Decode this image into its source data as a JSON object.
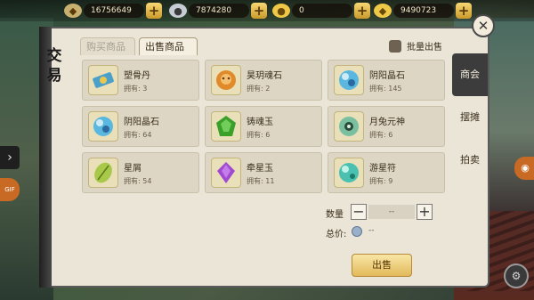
{
  "currencies": [
    {
      "name": "silver-ingot",
      "value": "16756649"
    },
    {
      "name": "silver-coin",
      "value": "7874280"
    },
    {
      "name": "gold-coin",
      "value": "0"
    },
    {
      "name": "gold-ingot",
      "value": "9490723"
    }
  ],
  "panel": {
    "title_line1": "交",
    "title_line2": "易",
    "tabs": [
      "购买商品",
      "出售商品"
    ],
    "active_tab": "出售商品",
    "batch_sell_label": "批量出售",
    "batch_sell_checked": false
  },
  "goods": [
    {
      "name": "塑骨丹",
      "own": "拥有: 3",
      "icon": "scroll-pill-icon",
      "color": "#4aa0c8"
    },
    {
      "name": "昊玥魂石",
      "own": "拥有: 2",
      "icon": "soul-stone-icon",
      "color": "#e08a2a"
    },
    {
      "name": "阴阳晶石",
      "own": "拥有: 145",
      "icon": "crystal-orb-icon",
      "color": "#5ab8e0"
    },
    {
      "name": "阴阳晶石",
      "own": "拥有: 64",
      "icon": "crystal-orb-icon",
      "color": "#5ab8e0"
    },
    {
      "name": "铸魂玉",
      "own": "拥有: 6",
      "icon": "green-jade-icon",
      "color": "#3aa02a"
    },
    {
      "name": "月兔元神",
      "own": "拥有: 6",
      "icon": "moon-rabbit-icon",
      "color": "#7ac0a0"
    },
    {
      "name": "星屑",
      "own": "拥有: 54",
      "icon": "star-leaf-icon",
      "color": "#a8c84a"
    },
    {
      "name": "牵星玉",
      "own": "拥有: 11",
      "icon": "purple-gem-icon",
      "color": "#a04ad0"
    },
    {
      "name": "游星符",
      "own": "拥有: 9",
      "icon": "cyan-orb-icon",
      "color": "#4ac0b0"
    }
  ],
  "side_tabs": [
    {
      "label": "商会",
      "active": true
    },
    {
      "label": "摆摊",
      "active": false
    },
    {
      "label": "拍卖",
      "active": false
    }
  ],
  "trade": {
    "qty_label": "数量",
    "qty_value": "--",
    "price_label": "总价:",
    "price_value": "--",
    "sell_label": "出售"
  },
  "outside": {
    "gif_label": "GIF"
  }
}
